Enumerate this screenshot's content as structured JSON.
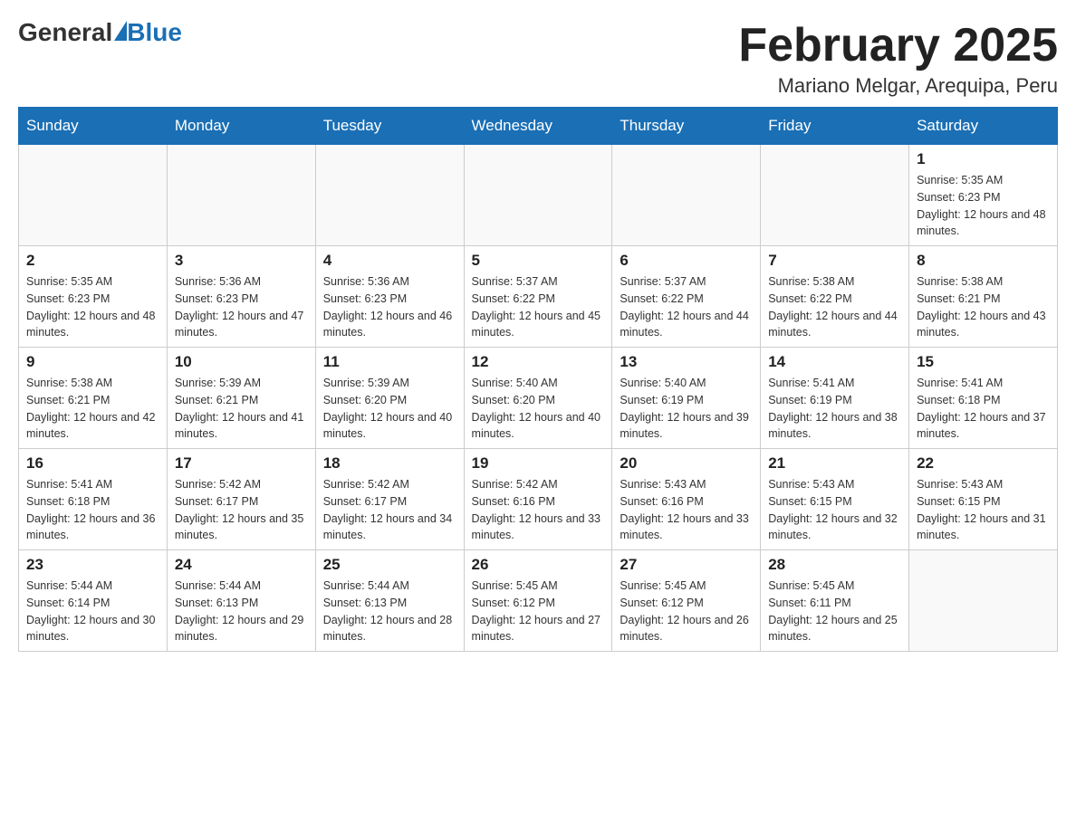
{
  "header": {
    "logo": {
      "general": "General",
      "blue": "Blue"
    },
    "title": "February 2025",
    "location": "Mariano Melgar, Arequipa, Peru"
  },
  "weekdays": [
    "Sunday",
    "Monday",
    "Tuesday",
    "Wednesday",
    "Thursday",
    "Friday",
    "Saturday"
  ],
  "weeks": [
    [
      {
        "day": "",
        "info": ""
      },
      {
        "day": "",
        "info": ""
      },
      {
        "day": "",
        "info": ""
      },
      {
        "day": "",
        "info": ""
      },
      {
        "day": "",
        "info": ""
      },
      {
        "day": "",
        "info": ""
      },
      {
        "day": "1",
        "sunrise": "5:35 AM",
        "sunset": "6:23 PM",
        "daylight": "12 hours and 48 minutes."
      }
    ],
    [
      {
        "day": "2",
        "sunrise": "5:35 AM",
        "sunset": "6:23 PM",
        "daylight": "12 hours and 48 minutes."
      },
      {
        "day": "3",
        "sunrise": "5:36 AM",
        "sunset": "6:23 PM",
        "daylight": "12 hours and 47 minutes."
      },
      {
        "day": "4",
        "sunrise": "5:36 AM",
        "sunset": "6:23 PM",
        "daylight": "12 hours and 46 minutes."
      },
      {
        "day": "5",
        "sunrise": "5:37 AM",
        "sunset": "6:22 PM",
        "daylight": "12 hours and 45 minutes."
      },
      {
        "day": "6",
        "sunrise": "5:37 AM",
        "sunset": "6:22 PM",
        "daylight": "12 hours and 44 minutes."
      },
      {
        "day": "7",
        "sunrise": "5:38 AM",
        "sunset": "6:22 PM",
        "daylight": "12 hours and 44 minutes."
      },
      {
        "day": "8",
        "sunrise": "5:38 AM",
        "sunset": "6:21 PM",
        "daylight": "12 hours and 43 minutes."
      }
    ],
    [
      {
        "day": "9",
        "sunrise": "5:38 AM",
        "sunset": "6:21 PM",
        "daylight": "12 hours and 42 minutes."
      },
      {
        "day": "10",
        "sunrise": "5:39 AM",
        "sunset": "6:21 PM",
        "daylight": "12 hours and 41 minutes."
      },
      {
        "day": "11",
        "sunrise": "5:39 AM",
        "sunset": "6:20 PM",
        "daylight": "12 hours and 40 minutes."
      },
      {
        "day": "12",
        "sunrise": "5:40 AM",
        "sunset": "6:20 PM",
        "daylight": "12 hours and 40 minutes."
      },
      {
        "day": "13",
        "sunrise": "5:40 AM",
        "sunset": "6:19 PM",
        "daylight": "12 hours and 39 minutes."
      },
      {
        "day": "14",
        "sunrise": "5:41 AM",
        "sunset": "6:19 PM",
        "daylight": "12 hours and 38 minutes."
      },
      {
        "day": "15",
        "sunrise": "5:41 AM",
        "sunset": "6:18 PM",
        "daylight": "12 hours and 37 minutes."
      }
    ],
    [
      {
        "day": "16",
        "sunrise": "5:41 AM",
        "sunset": "6:18 PM",
        "daylight": "12 hours and 36 minutes."
      },
      {
        "day": "17",
        "sunrise": "5:42 AM",
        "sunset": "6:17 PM",
        "daylight": "12 hours and 35 minutes."
      },
      {
        "day": "18",
        "sunrise": "5:42 AM",
        "sunset": "6:17 PM",
        "daylight": "12 hours and 34 minutes."
      },
      {
        "day": "19",
        "sunrise": "5:42 AM",
        "sunset": "6:16 PM",
        "daylight": "12 hours and 33 minutes."
      },
      {
        "day": "20",
        "sunrise": "5:43 AM",
        "sunset": "6:16 PM",
        "daylight": "12 hours and 33 minutes."
      },
      {
        "day": "21",
        "sunrise": "5:43 AM",
        "sunset": "6:15 PM",
        "daylight": "12 hours and 32 minutes."
      },
      {
        "day": "22",
        "sunrise": "5:43 AM",
        "sunset": "6:15 PM",
        "daylight": "12 hours and 31 minutes."
      }
    ],
    [
      {
        "day": "23",
        "sunrise": "5:44 AM",
        "sunset": "6:14 PM",
        "daylight": "12 hours and 30 minutes."
      },
      {
        "day": "24",
        "sunrise": "5:44 AM",
        "sunset": "6:13 PM",
        "daylight": "12 hours and 29 minutes."
      },
      {
        "day": "25",
        "sunrise": "5:44 AM",
        "sunset": "6:13 PM",
        "daylight": "12 hours and 28 minutes."
      },
      {
        "day": "26",
        "sunrise": "5:45 AM",
        "sunset": "6:12 PM",
        "daylight": "12 hours and 27 minutes."
      },
      {
        "day": "27",
        "sunrise": "5:45 AM",
        "sunset": "6:12 PM",
        "daylight": "12 hours and 26 minutes."
      },
      {
        "day": "28",
        "sunrise": "5:45 AM",
        "sunset": "6:11 PM",
        "daylight": "12 hours and 25 minutes."
      },
      {
        "day": "",
        "info": ""
      }
    ]
  ]
}
